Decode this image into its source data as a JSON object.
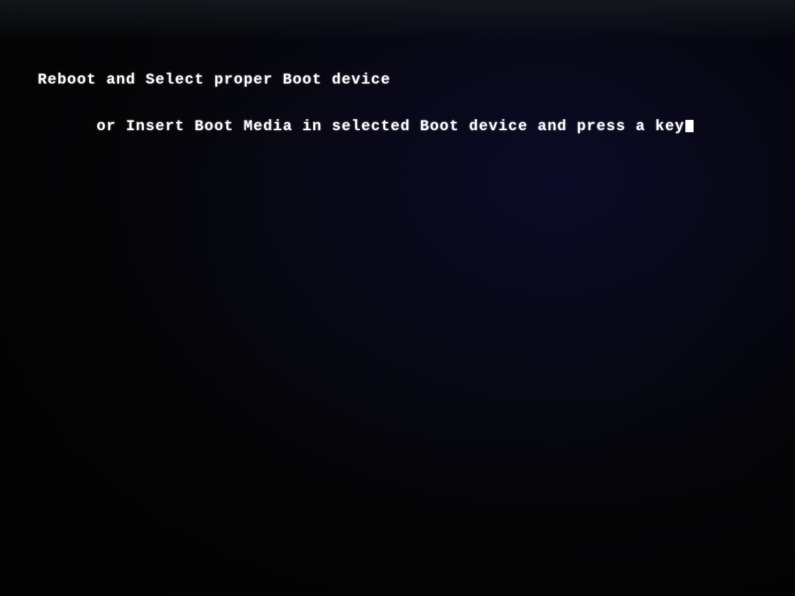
{
  "screen": {
    "background_color": "#080810",
    "bios_message": {
      "line1": "Reboot and Select proper Boot device",
      "line2_prefix": "or Insert Boot Media in selected Boot device and press a key",
      "cursor_symbol": "_"
    }
  }
}
